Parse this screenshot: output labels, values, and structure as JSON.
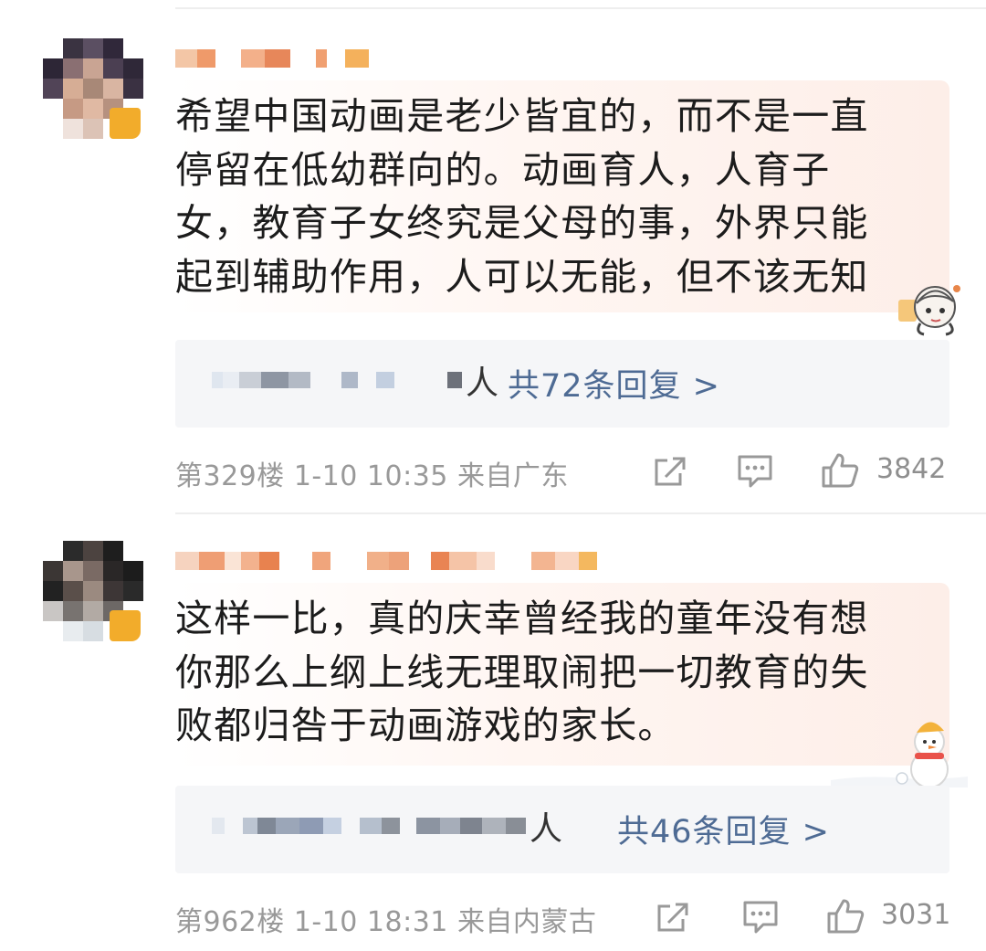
{
  "comments": [
    {
      "text_lines": [
        "希望中国动画是老少皆宜的，而不是一直",
        "停留在低幼群向的。动画育人，人育子",
        "女，教育子女终究是父母的事，外界只能",
        "起到辅助作用，人可以无能，但不该无知"
      ],
      "replies_suffix": "人",
      "replies_link": "共72条回复 >",
      "floor": "第329楼",
      "time": "1-10 10:35",
      "location": "来自广东",
      "likes": "3842",
      "sticker_icon": "anime-girl-sticker-icon"
    },
    {
      "text_lines": [
        "这样一比，真的庆幸曾经我的童年没有想",
        "你那么上纲上线无理取闹把一切教育的失",
        "败都归咎于动画游戏的家长。"
      ],
      "replies_suffix": "人",
      "replies_link": "共46条回复 >",
      "floor": "第962楼",
      "time": "1-10 18:31",
      "location": "来自内蒙古",
      "likes": "3031",
      "sticker_icon": "snowman-sticker-icon"
    }
  ],
  "icons": [
    "share-icon",
    "comment-icon",
    "like-icon",
    "vip-badge-icon"
  ],
  "colors": {
    "link": "#4e6b94",
    "meta": "#999999",
    "reply_box": "#f5f6f8",
    "badge": "#f2ac2b"
  }
}
